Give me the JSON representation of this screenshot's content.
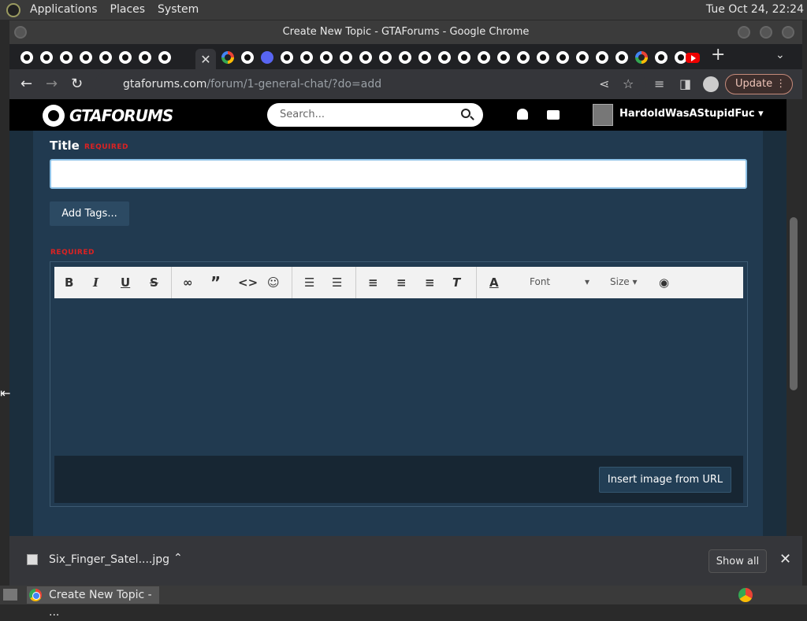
{
  "desktop": {
    "menus": [
      "Applications",
      "Places",
      "System"
    ],
    "clock": "Tue Oct 24, 22:24"
  },
  "window": {
    "title": "Create New Topic - GTAForums - Google Chrome"
  },
  "browser": {
    "url_host": "gtaforums.com",
    "url_path": "/forum/1-general-chat/?do=add",
    "update_label": "Update",
    "tab_close": "✕",
    "new_tab": "+",
    "tab_menu": "⌄"
  },
  "site": {
    "logo": "GTAFORUMS",
    "search_placeholder": "Search...",
    "username": "HardoldWasAStupidFuc ▾"
  },
  "form": {
    "title_label": "Title",
    "required": "REQUIRED",
    "add_tags": "Add Tags...",
    "font_label": "Font",
    "size_label": "Size",
    "insert_image": "Insert image from URL"
  },
  "download": {
    "filename": "Six_Finger_Satel....jpg",
    "show_all": "Show all"
  },
  "taskbar": {
    "window_label": "Create New Topic - ..."
  }
}
